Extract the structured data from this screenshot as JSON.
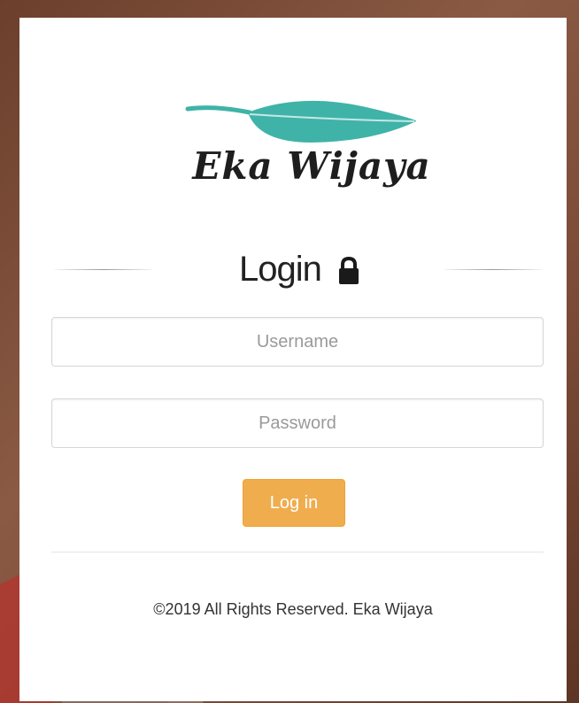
{
  "brand": {
    "name": "Eka Wijaya",
    "leaf_color": "#3fb3a8"
  },
  "heading": {
    "title": "Login",
    "icon": "lock-icon"
  },
  "form": {
    "username_placeholder": "Username",
    "password_placeholder": "Password",
    "submit_label": "Log in",
    "submit_color": "#f0ad4e"
  },
  "footer": {
    "text": "©2019 All Rights Reserved. Eka Wijaya"
  }
}
